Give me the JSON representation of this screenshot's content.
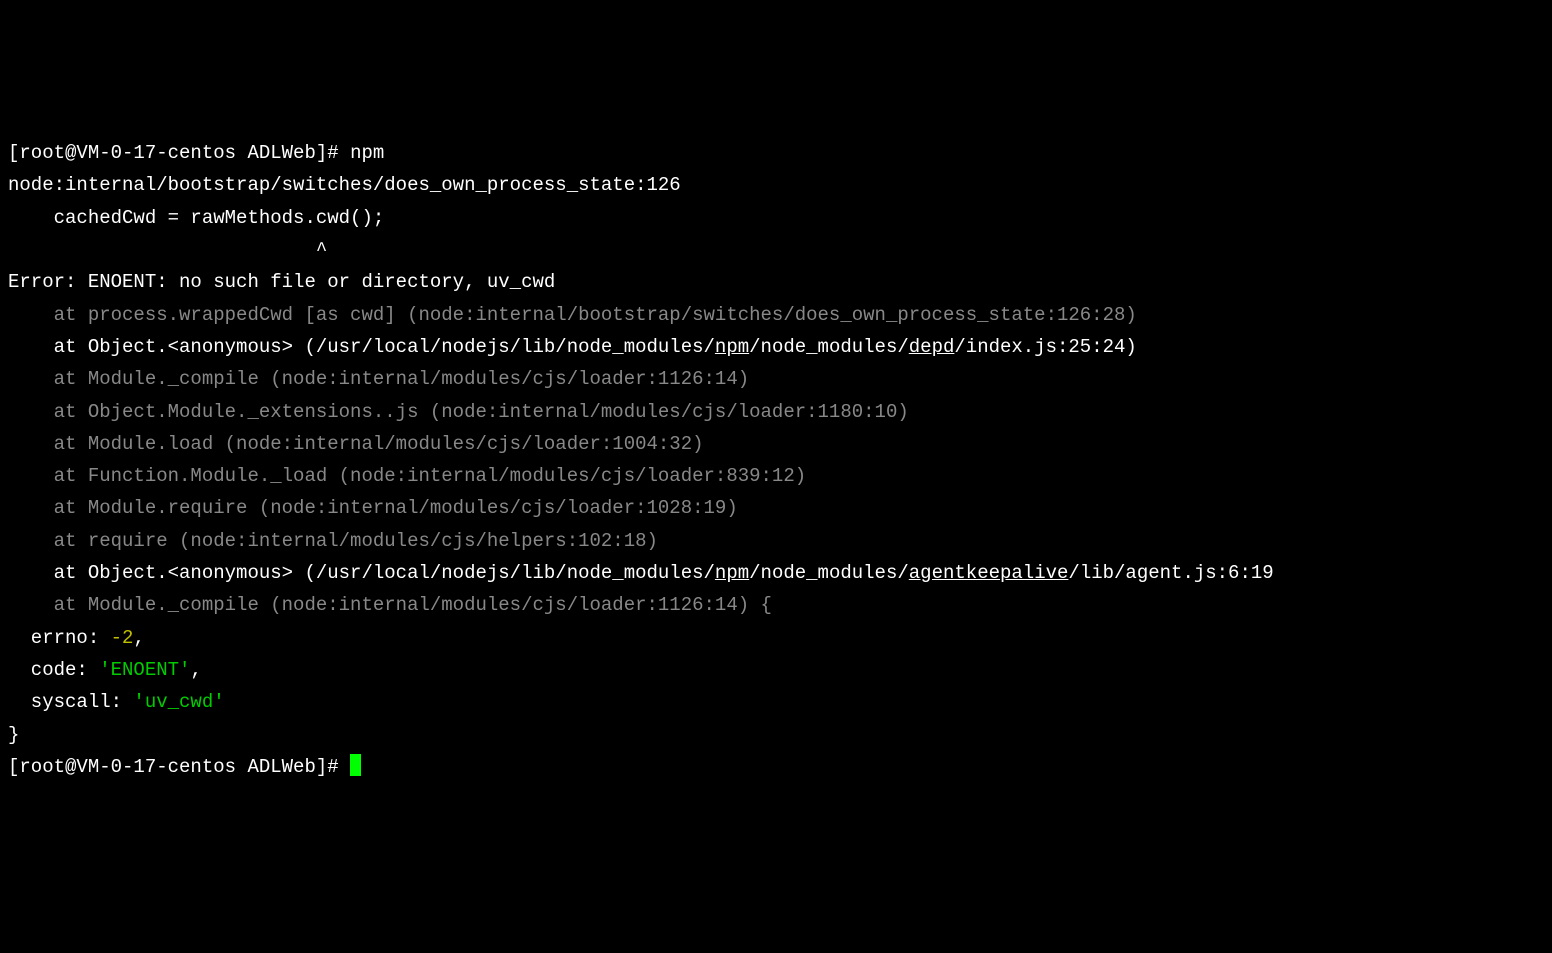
{
  "prompt1_open": "[root@VM-0-17-centos ADLWeb]# ",
  "command": "npm",
  "trace_header": "node:internal/bootstrap/switches/does_own_process_state:126",
  "code_line": "    cachedCwd = rawMethods.cwd();",
  "caret_line": "                           ^",
  "blank": "",
  "error_line": "Error: ENOENT: no such file or directory, uv_cwd",
  "stack": [
    "    at process.wrappedCwd [as cwd] (node:internal/bootstrap/switches/does_own_process_state:126:28)",
    {
      "pre": "    at Object.<anonymous> (/usr/local/nodejs/lib/node_modules/",
      "u1": "npm",
      "mid": "/node_modules/",
      "u2": "depd",
      "post": "/index.js:25:24)"
    },
    "    at Module._compile (node:internal/modules/cjs/loader:1126:14)",
    "    at Object.Module._extensions..js (node:internal/modules/cjs/loader:1180:10)",
    "    at Module.load (node:internal/modules/cjs/loader:1004:32)",
    "    at Function.Module._load (node:internal/modules/cjs/loader:839:12)",
    "    at Module.require (node:internal/modules/cjs/loader:1028:19)",
    "    at require (node:internal/modules/cjs/helpers:102:18)",
    {
      "pre": "    at Object.<anonymous> (/usr/local/nodejs/lib/node_modules/",
      "u1": "npm",
      "mid": "/node_modules/",
      "u2": "agentkeepalive",
      "post": "/lib/agent.js:6:19"
    },
    "    at Module._compile (node:internal/modules/cjs/loader:1126:14) {"
  ],
  "errno_label": "  errno: ",
  "errno_value": "-2",
  "errno_comma": ",",
  "code_label": "  code: ",
  "code_value": "'ENOENT'",
  "code_comma": ",",
  "syscall_label": "  syscall: ",
  "syscall_value": "'uv_cwd'",
  "close_brace": "}",
  "prompt2_open": "[root@VM-0-17-centos ADLWeb]# "
}
